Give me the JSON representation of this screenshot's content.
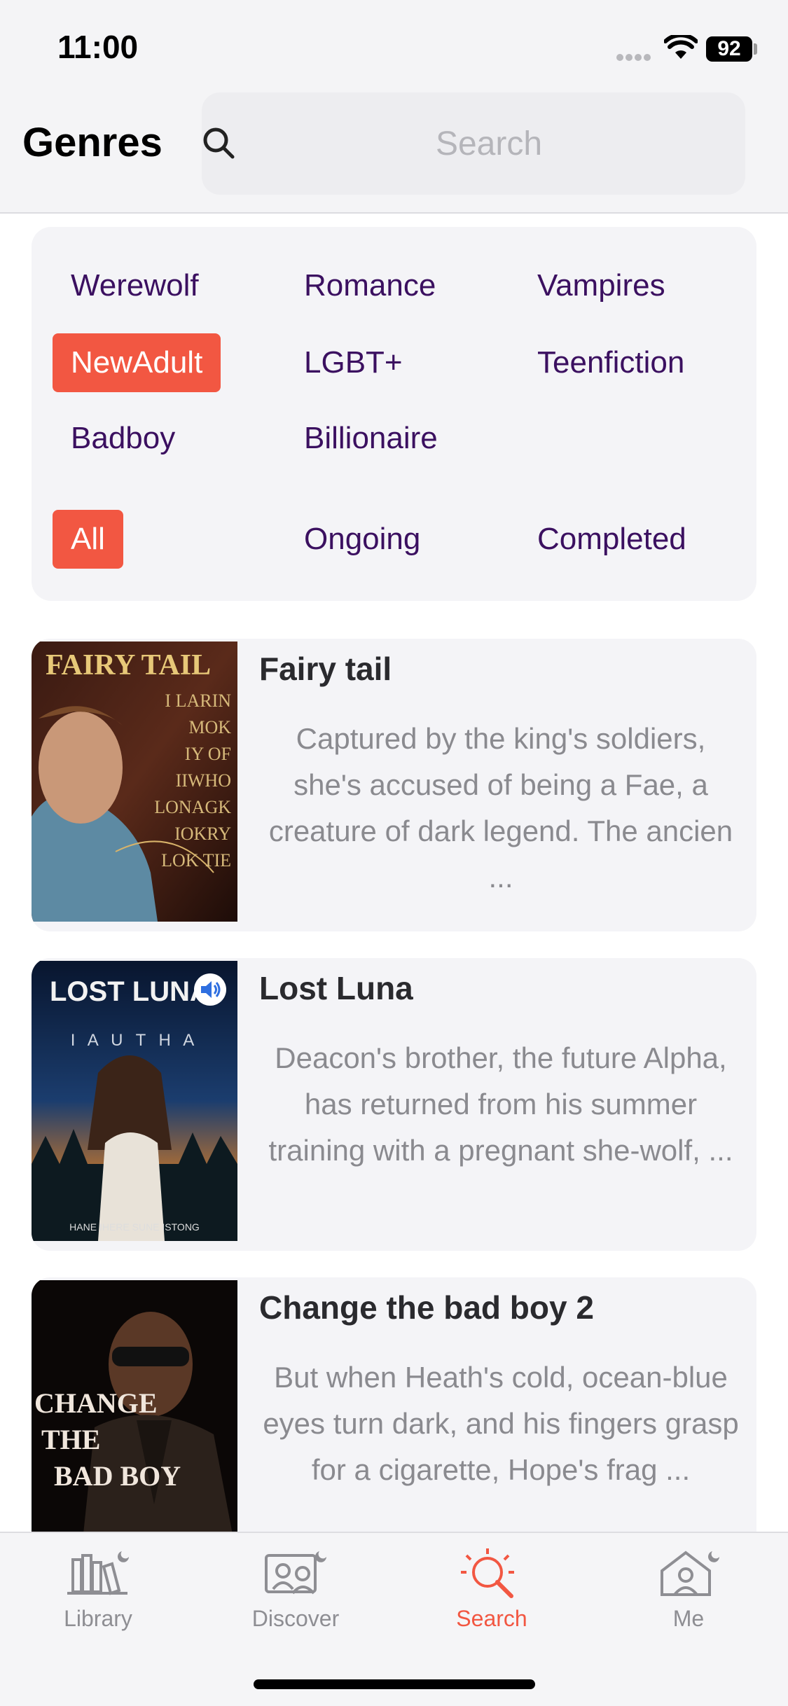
{
  "status": {
    "time": "11:00",
    "battery": "92"
  },
  "header": {
    "title": "Genres"
  },
  "search": {
    "placeholder": "Search"
  },
  "genres": [
    "Werewolf",
    "Romance",
    "Vampires",
    "NewAdult",
    "LGBT+",
    "Teenfiction",
    "Badboy",
    "Billionaire"
  ],
  "genre_selected": "NewAdult",
  "filters": [
    "All",
    "Ongoing",
    "Completed"
  ],
  "filter_selected": "All",
  "books": [
    {
      "title": "Fairy tail",
      "description": "Captured by the king's soldiers, she's accused of being a Fae, a creature of dark legend. The ancien ...",
      "cover_title": "FAIRY TAIL",
      "cover_text": [
        "I LARIN",
        "MOK",
        "IY OF",
        "IIWHO",
        "LONAGK",
        "IOKRY",
        "LOK TIE"
      ]
    },
    {
      "title": "Lost Luna",
      "description": "Deacon's brother, the future Alpha, has returned from his summer training with a pregnant she-wolf, ...",
      "cover_title": "LOST LUNA",
      "cover_subtitle": "I A U T H A",
      "cover_footer": "HANE IHERE SUNE ISTONG"
    },
    {
      "title": "Change the bad boy 2",
      "description": "But when Heath's cold, ocean-blue eyes turn dark, and his fingers grasp for a cigarette, Hope's frag ...",
      "cover_title": [
        "CHANGE",
        "THE",
        "BAD BOY"
      ]
    }
  ],
  "tabs": [
    {
      "label": "Library",
      "icon": "library-icon"
    },
    {
      "label": "Discover",
      "icon": "discover-icon"
    },
    {
      "label": "Search",
      "icon": "search-tab-icon"
    },
    {
      "label": "Me",
      "icon": "me-icon"
    }
  ],
  "active_tab": "Search",
  "colors": {
    "accent": "#f25742",
    "genre_text": "#3b1060",
    "panel": "#f4f4f7"
  }
}
